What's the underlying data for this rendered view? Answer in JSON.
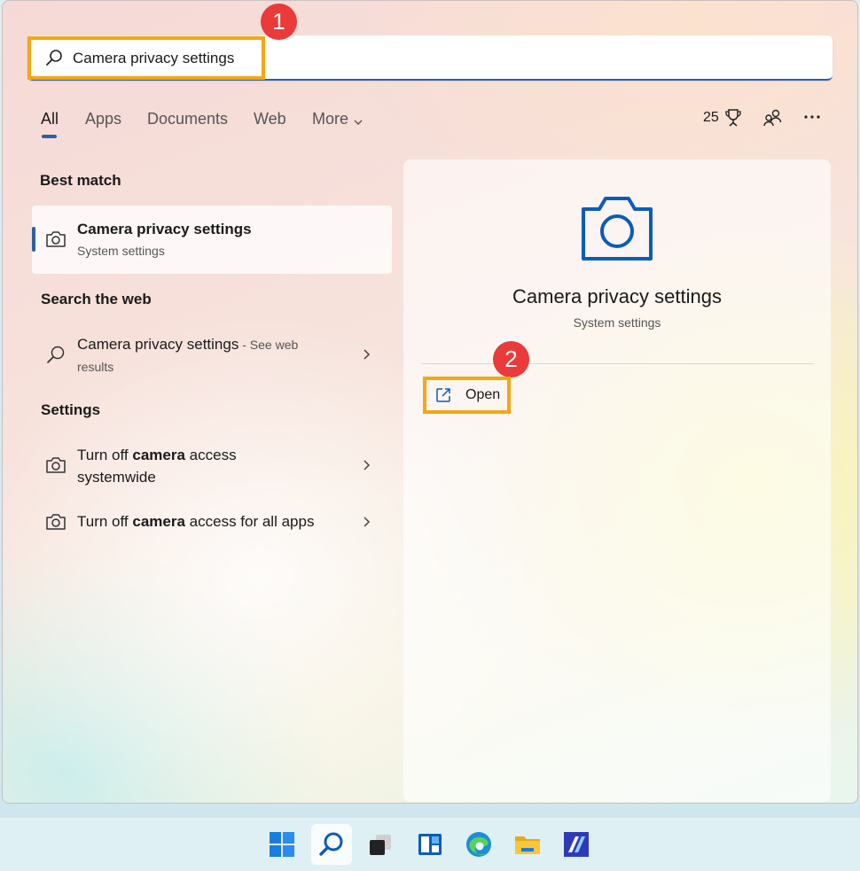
{
  "search": {
    "value": "Camera privacy settings",
    "placeholder": ""
  },
  "callouts": [
    "1",
    "2"
  ],
  "tabs": [
    {
      "label": "All",
      "active": true
    },
    {
      "label": "Apps"
    },
    {
      "label": "Documents"
    },
    {
      "label": "Web"
    },
    {
      "label": "More"
    }
  ],
  "toolbar": {
    "points": "25",
    "icons": [
      "trophy-icon",
      "account-switch-icon",
      "more-options-icon"
    ]
  },
  "best_match": {
    "heading": "Best match",
    "title": "Camera privacy settings",
    "subtitle": "System settings",
    "icon": "camera-icon"
  },
  "web": {
    "heading": "Search the web",
    "title": "Camera privacy settings",
    "suffix": " - See web",
    "suffix2": "results",
    "icon": "search-icon"
  },
  "settings": {
    "heading": "Settings",
    "items": [
      {
        "pre": "Turn off ",
        "bold": "camera",
        "post": " access",
        "line2": "systemwide"
      },
      {
        "pre": "Turn off ",
        "bold": "camera",
        "post": " access for all apps"
      }
    ]
  },
  "preview": {
    "title": "Camera privacy settings",
    "subtitle": "System settings",
    "open_label": "Open",
    "icon": "camera-icon"
  },
  "taskbar": {
    "apps": [
      "windows-start-icon",
      "search-icon",
      "task-view-icon",
      "widgets-icon",
      "edge-icon",
      "file-explorer-icon",
      "app-icon"
    ]
  },
  "colors": {
    "accent": "#2b5fa8",
    "highlight": "#f3a712",
    "callout": "#ea3a3a"
  }
}
